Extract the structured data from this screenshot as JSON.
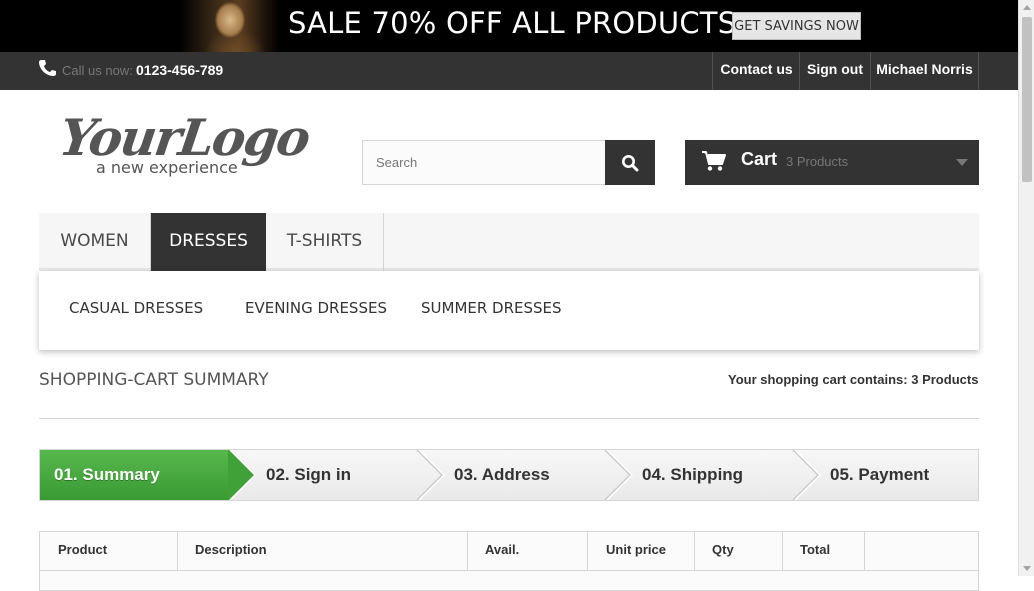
{
  "banner": {
    "headline": "SALE 70% OFF ALL PRODUCTS",
    "button_label": "GET SAVINGS NOW"
  },
  "topbar": {
    "phone_label": "Call us now:",
    "phone_number": "0123-456-789",
    "links": [
      "Contact us",
      "Sign out",
      "Michael Norris"
    ]
  },
  "logo": {
    "main": "YourLogo",
    "sub": "a new experience"
  },
  "search": {
    "placeholder": "Search",
    "value": ""
  },
  "cart": {
    "label": "Cart",
    "count": "3 Products"
  },
  "menu": {
    "items": [
      "WOMEN",
      "DRESSES",
      "T-SHIRTS"
    ],
    "active": "DRESSES",
    "submenu": [
      "CASUAL DRESSES",
      "EVENING DRESSES",
      "SUMMER DRESSES"
    ]
  },
  "summary": {
    "title": "SHOPPING-CART SUMMARY",
    "contains_label": "Your shopping cart contains:",
    "contains_count": "3 Products"
  },
  "steps": [
    "01. Summary",
    "02. Sign in",
    "03. Address",
    "04. Shipping",
    "05. Payment"
  ],
  "table": {
    "headers": [
      "Product",
      "Description",
      "Avail.",
      "Unit price",
      "Qty",
      "Total",
      ""
    ]
  },
  "colors": {
    "dark": "#333333",
    "active_step": "#46a74e",
    "banner": "#000000"
  }
}
